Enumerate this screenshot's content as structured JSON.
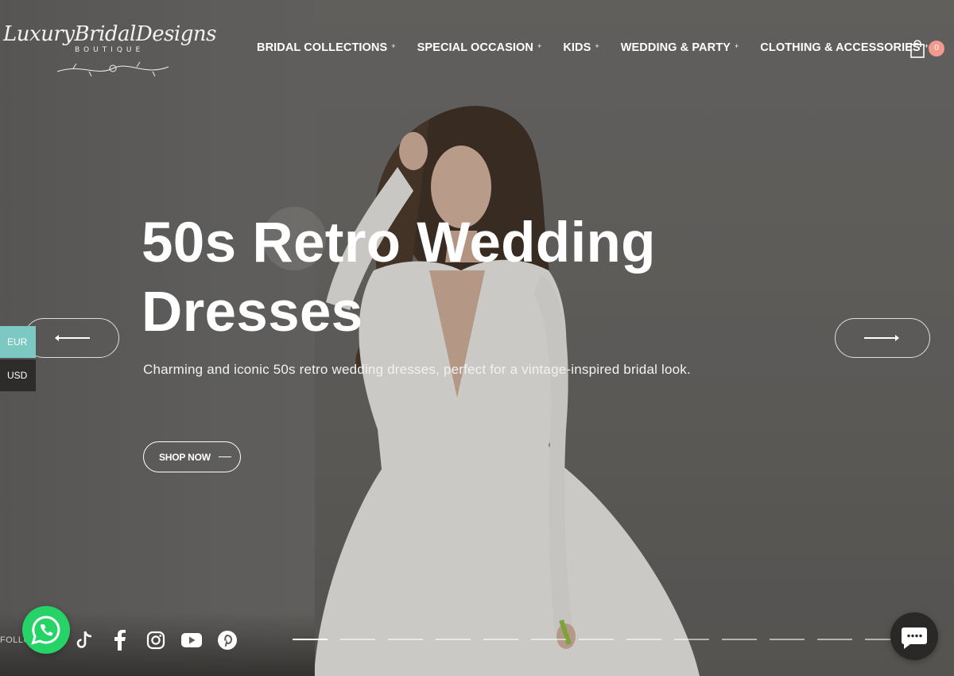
{
  "brand": {
    "name": "LuxuryBridalDesigns",
    "sub": "BOUTIQUE"
  },
  "nav": {
    "items": [
      {
        "label": "BRIDAL COLLECTIONS"
      },
      {
        "label": "SPECIAL OCCASION"
      },
      {
        "label": "KIDS"
      },
      {
        "label": "WEDDING & PARTY"
      },
      {
        "label": "CLOTHING & ACCESSORIES"
      }
    ],
    "expand_glyph": "+"
  },
  "cart": {
    "count": "0"
  },
  "hero": {
    "title_line1": "50s Retro Wedding",
    "title_line2": "Dresses",
    "subtitle": "Charming and iconic 50s retro wedding dresses, perfect for a vintage-inspired bridal look.",
    "cta": "SHOP NOW"
  },
  "currency": {
    "options": [
      "EUR",
      "USD"
    ],
    "selected": "EUR"
  },
  "footer": {
    "follow_label": "FOLLOW",
    "socials": [
      "tiktok-icon",
      "facebook-icon",
      "instagram-icon",
      "youtube-icon",
      "pinterest-icon"
    ]
  },
  "slider": {
    "active_index": 0
  },
  "colors": {
    "accent_teal": "#7cc8c3",
    "badge": "#f39a8f",
    "whatsapp": "#25d366"
  }
}
